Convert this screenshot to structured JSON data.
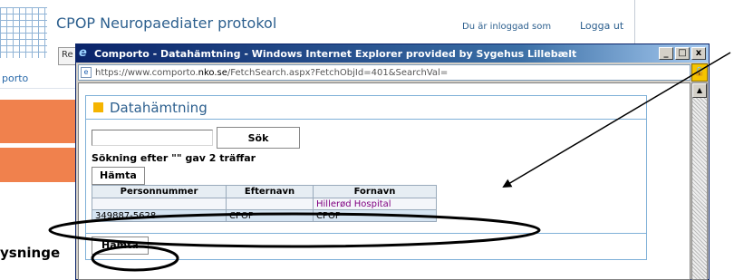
{
  "background": {
    "app_title": "CPOP Neuropaediater protokol",
    "logged_in": "Du är inloggad som",
    "logout": "Logga ut",
    "menu_button": "Re",
    "logo_text": "porto",
    "side_label": "ysninge"
  },
  "window": {
    "title": "Comporto - Datahämtning - Windows Internet Explorer provided by Sygehus Lillebælt",
    "url_prefix": "https://www.comporto.",
    "url_domain": "nko.se",
    "url_rest": "/FetchSearch.aspx?FetchObjId=401&SearchVal=",
    "minimize": "_",
    "maximize": "□",
    "close": "x"
  },
  "panel": {
    "title": "Datahämtning",
    "search_value": "",
    "search_button": "Sök",
    "result_text": "Sökning efter \"\" gav 2 träffar",
    "fetch_button_top": "Hämta",
    "fetch_button_bottom": "Hämta",
    "columns": [
      "Personnummer",
      "Efternavn",
      "Fornavn"
    ],
    "rows": [
      [
        "",
        "",
        "Hillerød Hospital"
      ],
      [
        "349887-5628",
        "CPOP",
        "CPOP"
      ]
    ]
  },
  "colors": {
    "accent": "#f5b400",
    "titlebar": "#0a246a",
    "panel_border": "#7fb0d8",
    "annotation": "#000000"
  }
}
